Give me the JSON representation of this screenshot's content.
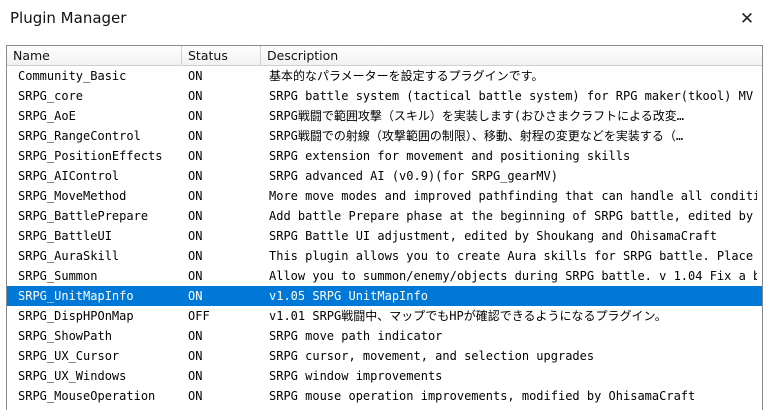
{
  "window": {
    "title": "Plugin Manager",
    "close_glyph": "✕"
  },
  "table": {
    "columns": {
      "name": "Name",
      "status": "Status",
      "description": "Description"
    },
    "rows": [
      {
        "name": "Community_Basic",
        "status": "ON",
        "description": "基本的なパラメーターを設定するプラグインです。"
      },
      {
        "name": "SRPG_core",
        "status": "ON",
        "description": "SRPG battle system (tactical battle system) for RPG maker(tkool) MV …"
      },
      {
        "name": "SRPG_AoE",
        "status": "ON",
        "description": "SRPG戦闘で範囲攻撃（スキル）を実装します(おひさまクラフトによる改変…"
      },
      {
        "name": "SRPG_RangeControl",
        "status": "ON",
        "description": "SRPG戦闘での射線（攻撃範囲の制限）、移動、射程の変更などを実装する（…"
      },
      {
        "name": "SRPG_PositionEffects",
        "status": "ON",
        "description": "SRPG extension for movement and positioning skills"
      },
      {
        "name": "SRPG_AIControl",
        "status": "ON",
        "description": "SRPG advanced AI (v0.9)(for SRPG_gearMV)"
      },
      {
        "name": "SRPG_MoveMethod",
        "status": "ON",
        "description": "More move modes and improved pathfinding that can handle all conditi…"
      },
      {
        "name": "SRPG_BattlePrepare",
        "status": "ON",
        "description": "Add battle Prepare phase at the beginning of SRPG battle, edited by …"
      },
      {
        "name": "SRPG_BattleUI",
        "status": "ON",
        "description": "SRPG Battle UI adjustment, edited by Shoukang and OhisamaCraft"
      },
      {
        "name": "SRPG_AuraSkill",
        "status": "ON",
        "description": "This plugin allows you to create Aura skills for SRPG battle. Place …"
      },
      {
        "name": "SRPG_Summon",
        "status": "ON",
        "description": "Allow you to summon/enemy/objects during SRPG battle. v 1.04 Fix a b…"
      },
      {
        "name": "SRPG_UnitMapInfo",
        "status": "ON",
        "description": "v1.05 SRPG UnitMapInfo",
        "selected": true
      },
      {
        "name": "SRPG_DispHPOnMap",
        "status": "OFF",
        "description": "v1.01 SRPG戦闘中、マップでもHPが確認できるようになるプラグイン。"
      },
      {
        "name": "SRPG_ShowPath",
        "status": "ON",
        "description": "SRPG move path indicator"
      },
      {
        "name": "SRPG_UX_Cursor",
        "status": "ON",
        "description": "SRPG cursor, movement, and selection upgrades"
      },
      {
        "name": "SRPG_UX_Windows",
        "status": "ON",
        "description": "SRPG window improvements"
      },
      {
        "name": "SRPG_MouseOperation",
        "status": "ON",
        "description": "SRPG mouse operation improvements, modified by OhisamaCraft"
      }
    ]
  },
  "colors": {
    "selection": "#0078d7",
    "header_border": "#cfcfcf"
  }
}
